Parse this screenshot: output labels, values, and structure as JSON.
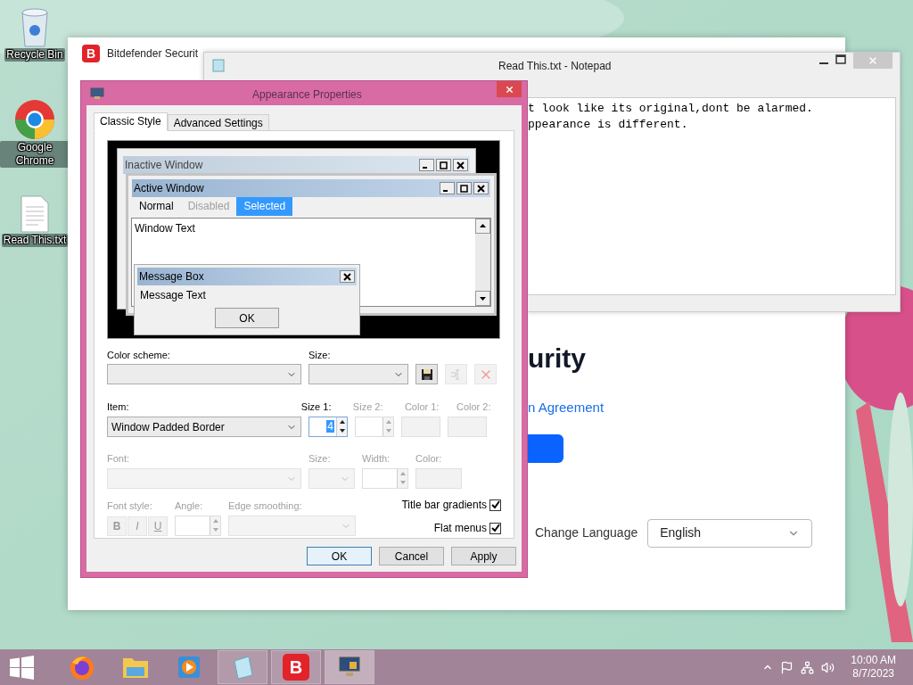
{
  "desktop": {
    "icons": [
      {
        "label": "Recycle Bin",
        "kind": "recycle"
      },
      {
        "label": "Google Chrome",
        "kind": "chrome"
      },
      {
        "label": "Read This.txt",
        "kind": "file"
      }
    ]
  },
  "bitdefender_window": {
    "logo": "B",
    "title": "Bitdefender Securit",
    "heading": "urity",
    "link": "n Agreement",
    "language_label": "Change Language",
    "language_value": "English"
  },
  "notepad": {
    "title": "Read This.txt - Notepad",
    "lines": [
      "t look like its original,dont be alarmed.",
      "ppearance is different."
    ]
  },
  "dialog": {
    "title": "Appearance Properties",
    "tabs": [
      {
        "label": "Classic Style",
        "selected": true
      },
      {
        "label": "Advanced Settings",
        "selected": false
      }
    ],
    "preview": {
      "inactive_title": "Inactive Window",
      "active_title": "Active Window",
      "menu": [
        {
          "label": "Normal",
          "disabled": false,
          "selected": false
        },
        {
          "label": "Disabled",
          "disabled": true,
          "selected": false
        },
        {
          "label": "Selected",
          "disabled": false,
          "selected": true
        }
      ],
      "window_text": "Window Text",
      "message_title": "Message Box",
      "message_text": "Message Text",
      "ok": "OK"
    },
    "color_scheme": {
      "label": "Color scheme:",
      "disabled": false
    },
    "size": {
      "label": "Size:",
      "disabled": false
    },
    "scheme_buttons": [
      {
        "kind": "save",
        "disabled": false
      },
      {
        "kind": "rename",
        "disabled": true
      },
      {
        "kind": "delete",
        "disabled": true
      }
    ],
    "item": {
      "label": "Item:",
      "value": "Window Padded Border",
      "disabled": false
    },
    "item_fields": [
      {
        "label": "Size 1:",
        "value": "4",
        "kind": "spin",
        "disabled": false
      },
      {
        "label": "Size 2:",
        "kind": "spin",
        "disabled": true
      },
      {
        "label": "Color 1:",
        "kind": "color",
        "disabled": true
      },
      {
        "label": "Color 2:",
        "kind": "color",
        "disabled": true
      }
    ],
    "font": {
      "label": "Font:",
      "disabled": true
    },
    "font_fields": [
      {
        "label": "Size:",
        "kind": "select",
        "disabled": true
      },
      {
        "label": "Width:",
        "kind": "spin",
        "disabled": true
      },
      {
        "label": "Color:",
        "kind": "color",
        "disabled": true
      }
    ],
    "font_style": {
      "label": "Font style:",
      "buttons": [
        "B",
        "I",
        "U"
      ],
      "disabled": true
    },
    "angle": {
      "label": "Angle:",
      "disabled": true
    },
    "edge_smoothing": {
      "label": "Edge smoothing:",
      "disabled": true
    },
    "checkboxes": [
      {
        "label": "Title bar gradients",
        "checked": true
      },
      {
        "label": "Flat menus",
        "checked": true
      }
    ],
    "buttons": [
      {
        "label": "OK",
        "default": true
      },
      {
        "label": "Cancel",
        "default": false
      },
      {
        "label": "Apply",
        "default": false
      }
    ]
  },
  "taskbar": {
    "items": [
      {
        "kind": "firefox",
        "running": false,
        "selected": false
      },
      {
        "kind": "explorer",
        "running": false,
        "selected": false
      },
      {
        "kind": "media",
        "running": false,
        "selected": false
      },
      {
        "kind": "notepad",
        "running": true,
        "selected": false
      },
      {
        "kind": "bitdefender",
        "running": true,
        "selected": false,
        "logo": "B"
      },
      {
        "kind": "appearance",
        "running": true,
        "selected": true
      }
    ],
    "time": "10:00 AM",
    "date": "8/7/2023"
  }
}
